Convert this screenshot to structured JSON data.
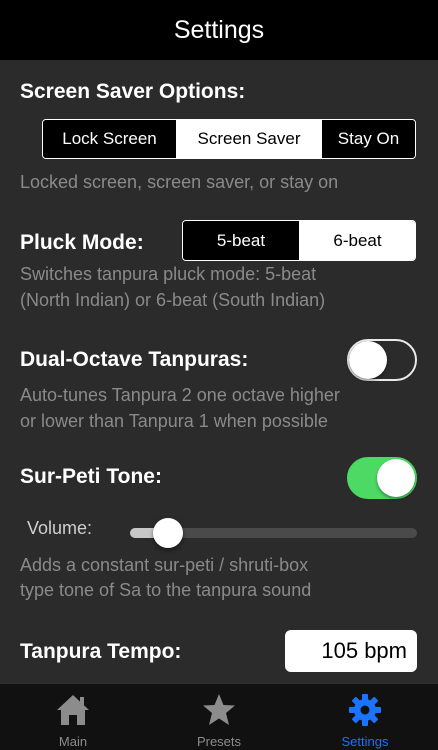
{
  "navbar": {
    "title": "Settings"
  },
  "screen_saver": {
    "label": "Screen Saver Options:",
    "options": [
      "Lock Screen",
      "Screen Saver",
      "Stay On"
    ],
    "selected_index": 1,
    "description": "Locked screen, screen saver, or stay on"
  },
  "pluck_mode": {
    "label": "Pluck Mode:",
    "options": [
      "5-beat",
      "6-beat"
    ],
    "selected_index": 1,
    "description_line1": "Switches tanpura pluck mode: 5-beat",
    "description_line2": "(North Indian) or 6-beat (South Indian)"
  },
  "dual_octave": {
    "label": "Dual-Octave Tanpuras:",
    "enabled": false,
    "description_line1": "Auto-tunes Tanpura 2 one octave higher",
    "description_line2": "or lower than Tanpura 1 when possible"
  },
  "sur_peti": {
    "label": "Sur-Peti Tone:",
    "enabled": true,
    "volume_label": "Volume:",
    "volume_fraction": 0.09,
    "description_line1": "Adds a constant sur-peti / shruti-box",
    "description_line2": "type tone of Sa to the tanpura sound"
  },
  "tempo": {
    "label": "Tanpura Tempo:",
    "value": "105 bpm"
  },
  "tabbar": {
    "tabs": [
      {
        "label": "Main",
        "icon": "home-icon"
      },
      {
        "label": "Presets",
        "icon": "star-icon"
      },
      {
        "label": "Settings",
        "icon": "gear-icon"
      }
    ],
    "active_index": 2
  },
  "colors": {
    "background": "#2b2b2b",
    "navbar": "#000000",
    "toggle_on": "#4cd964",
    "tab_active": "#1a74ff",
    "description": "#8a8a8a"
  }
}
